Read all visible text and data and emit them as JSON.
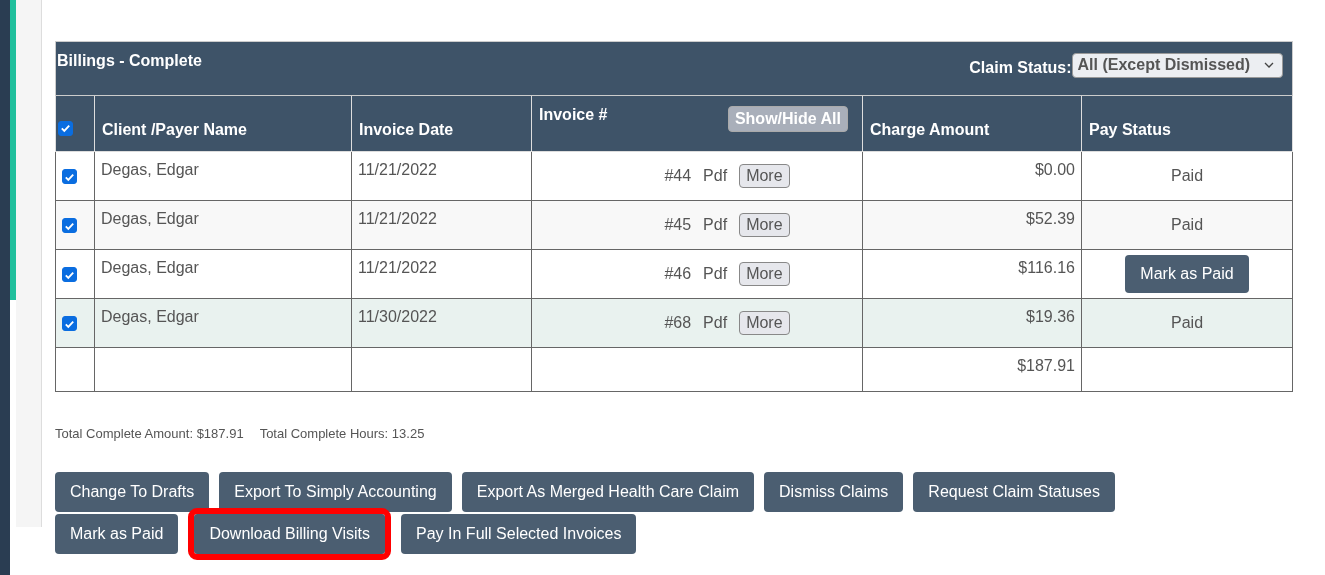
{
  "panel": {
    "title": "Billings - Complete",
    "filter_label": "Claim Status:",
    "filter_value": "All (Except Dismissed)"
  },
  "table": {
    "select_all_checked": true,
    "columns": [
      "Client /Payer Name",
      "Invoice Date",
      "Invoice #",
      "Charge Amount",
      "Pay Status"
    ],
    "show_hide_button": "Show/Hide All",
    "rows": [
      {
        "checked": true,
        "highlighted": false,
        "client": "Degas, Edgar",
        "date": "11/21/2022",
        "invoice": "#44",
        "pdf": "Pdf",
        "more": "More",
        "amount": "$0.00",
        "pay_status": {
          "kind": "text",
          "label": "Paid"
        }
      },
      {
        "checked": true,
        "highlighted": false,
        "client": "Degas, Edgar",
        "date": "11/21/2022",
        "invoice": "#45",
        "pdf": "Pdf",
        "more": "More",
        "amount": "$52.39",
        "pay_status": {
          "kind": "text",
          "label": "Paid"
        }
      },
      {
        "checked": true,
        "highlighted": false,
        "client": "Degas, Edgar",
        "date": "11/21/2022",
        "invoice": "#46",
        "pdf": "Pdf",
        "more": "More",
        "amount": "$116.16",
        "pay_status": {
          "kind": "button",
          "label": "Mark as Paid"
        }
      },
      {
        "checked": true,
        "highlighted": true,
        "client": "Degas, Edgar",
        "date": "11/30/2022",
        "invoice": "#68",
        "pdf": "Pdf",
        "more": "More",
        "amount": "$19.36",
        "pay_status": {
          "kind": "text",
          "label": "Paid"
        }
      }
    ],
    "total": "$187.91"
  },
  "summary": [
    "Total Complete Amount: $187.91",
    "Total Complete Hours: 13.25"
  ],
  "buttons": [
    {
      "label": "Change To Drafts",
      "highlighted": false
    },
    {
      "label": "Export To Simply Accounting",
      "highlighted": false
    },
    {
      "label": "Export As Merged Health Care Claim",
      "highlighted": false
    },
    {
      "label": "Dismiss Claims",
      "highlighted": false
    },
    {
      "label": "Request Claim Statuses",
      "highlighted": false
    },
    {
      "label": "Mark as Paid",
      "highlighted": false
    },
    {
      "label": "Download Billing Visits",
      "highlighted": true
    },
    {
      "label": "Pay In Full Selected Invoices",
      "highlighted": false
    }
  ]
}
